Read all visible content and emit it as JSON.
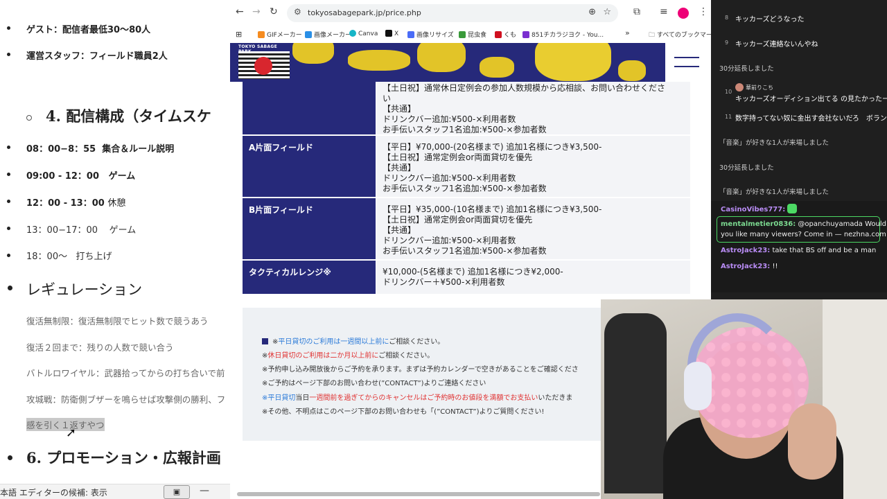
{
  "doc": {
    "bullets_top": [
      {
        "text": "ゲスト：配信者最低30〜80人"
      },
      {
        "text": "運営スタッフ：フィールド職員2人"
      }
    ],
    "section4": "4. 配信構成（タイムスケ",
    "schedule": [
      {
        "time": "08：00−8：55",
        "text": "集合＆ルール説明"
      },
      {
        "time": "09:00 - 12：00",
        "text": "ゲーム"
      },
      {
        "time": "12：00 - 13：00",
        "text": "休憩"
      },
      {
        "time": "13：00−17：00",
        "text": "ゲーム"
      },
      {
        "time": "18：00〜",
        "text": "打ち上げ"
      }
    ],
    "regulation_heading": "レギュレーション",
    "regulations": [
      "復活無制限：復活無制限でヒット数で競うあう",
      "復活２回まで：残りの人数で競い合う",
      "バトルロワイヤル：武器拾ってからの打ち合いで前",
      "攻城戦：防衛側ブザーを鳴らせば攻撃側の勝利、フ",
      "感を引く１返すやつ"
    ],
    "section6": "6. プロモーション・広報計画",
    "status_left": "本語  エディターの候補: 表示"
  },
  "browser": {
    "url": "tokyosabagepark.jp/price.php",
    "bookmarks": [
      {
        "label": "GIFメーカー",
        "color": "#f58b1f"
      },
      {
        "label": "画像メーカー",
        "color": "#2a8fe6"
      },
      {
        "label": "Canva",
        "color": "#16b5c7"
      },
      {
        "label": "X",
        "color": "#111111"
      },
      {
        "label": "画像リサイズ",
        "color": "#4a6cf7"
      },
      {
        "label": "昆虫食",
        "color": "#3a9a3a"
      },
      {
        "label": "くも",
        "color": "#d01020"
      },
      {
        "label": "851チカラジヨク - You...",
        "color": "#7b2fd0"
      }
    ],
    "bookmarks_more": "»",
    "all_bookmarks": "すべてのブックマーク",
    "logo_text": "TOKYO SABAGE PARK"
  },
  "pricing": [
    {
      "name": "",
      "lines": [
        "【土日祝】通常休日定例会の参加人数規模から応相談、お問い合わせくださ",
        "い",
        "【共通】",
        "ドリンクバー追加:¥500-×利用者数",
        "お手伝いスタッフ1名追加:¥500-×参加者数"
      ]
    },
    {
      "name": "A片面フィールド",
      "lines": [
        "【平日】¥70,000-(20名様まで) 追加1名様につき¥3,500-",
        "【土日祝】通常定例会or両面貸切を優先",
        "【共通】",
        "ドリンクバー追加:¥500-×利用者数",
        "お手伝いスタッフ1名追加:¥500-×参加者数"
      ]
    },
    {
      "name": "B片面フィールド",
      "lines": [
        "【平日】¥35,000-(10名様まで) 追加1名様につき¥3,500-",
        "【土日祝】通常定例会or両面貸切を優先",
        "【共通】",
        "ドリンクバー追加:¥500-×利用者数",
        "お手伝いスタッフ1名追加:¥500-×参加者数"
      ]
    },
    {
      "name": "タクティカルレンジ※",
      "lines": [
        "¥10,000-(5名様まで) 追加1名様につき¥2,000-",
        "ドリンクバー＋¥500-×利用者数"
      ]
    }
  ],
  "notes": {
    "n1_prefix": "※",
    "n1_blue": "平日貸切のご利用は一週間以上前に",
    "n1_rest": "ご相談ください。",
    "n2_prefix": "※",
    "n2_red": "休日貸切のご利用は二か月以上前に",
    "n2_rest": "ご相談ください。",
    "n3": "※予約申し込み開放後からご予約を承ります。まずは予約カレンダーで空きがあることをご確認くださ",
    "n4": "※ご予約はページ下部のお問い合わせ(”CONTACT”)よりご連絡ください",
    "n5_prefix": "※",
    "n5_blue": "平日貸切",
    "n5_mid": "当日",
    "n5_red": "一週間前を過ぎてからのキャンセルはご予約時のお値段を満額でお支払い",
    "n5_rest": "いただきま",
    "n6": "※その他、不明点はこのページ下部のお問い合わせも「(”CONTACT”)よりご質問ください!"
  },
  "chat": {
    "items": [
      {
        "num": "8",
        "text": "キッカーズどうなった"
      },
      {
        "num": "9",
        "text": "キッカーズ連絡ないんやね"
      },
      {
        "sys": "30分延長しました"
      },
      {
        "num": "10",
        "user": "華前りこち",
        "text": "キッカーズオーディション出てる の見たかったー"
      },
      {
        "num": "11",
        "text": "数字持ってない奴に金出す会社ないだろ　ボランティア"
      },
      {
        "sys": "「音楽」が好きな1人が来場しました"
      },
      {
        "sys": "30分延長しました"
      },
      {
        "sys": "「音楽」が好きな1人が来場しました"
      }
    ],
    "twitch": [
      {
        "user": "CasinoVibes777:",
        "text": ""
      },
      {
        "user": "mentalmetier0836:",
        "text": "@opanchuyamada Would"
      },
      {
        "user": "",
        "text": "you like many viewers? Come in — nezhna.com"
      },
      {
        "user": "AstroJack23:",
        "text": "take that BS off and be a man"
      },
      {
        "user": "AstroJack23:",
        "text": "!!"
      }
    ]
  },
  "colors": {
    "brand_navy": "#26297a",
    "camo_yellow": "#e2c428",
    "note_blue": "#2b7ad8",
    "note_red": "#e03131",
    "chat_bg": "#1f1f1f",
    "twitch_user": "#b98cf5",
    "highlight_green": "#4cd964"
  },
  "icons": [
    "back-icon",
    "forward-icon",
    "reload-icon",
    "site-info-icon",
    "zoom-icon",
    "star-icon",
    "extensions-icon",
    "media-icon",
    "profile-avatar",
    "menu-dots-icon",
    "apps-grid-icon",
    "folder-icon",
    "hamburger-icon",
    "cursor-arrow-icon"
  ]
}
